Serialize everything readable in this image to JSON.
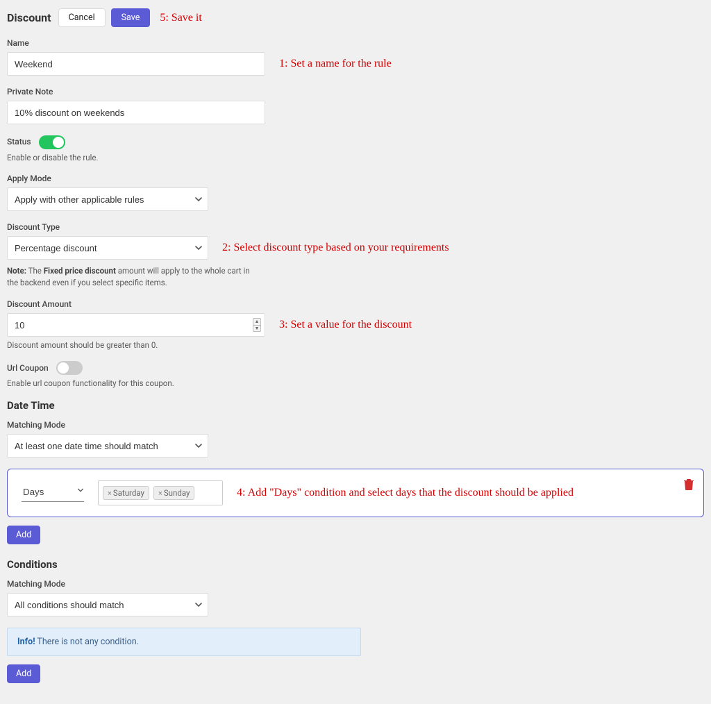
{
  "header": {
    "title": "Discount",
    "cancel": "Cancel",
    "save": "Save",
    "annot5": "5: Save it"
  },
  "name": {
    "label": "Name",
    "value": "Weekend",
    "annot1": "1: Set a name for the rule"
  },
  "privateNote": {
    "label": "Private Note",
    "value": "10% discount on weekends"
  },
  "status": {
    "label": "Status",
    "help": "Enable or disable the rule.",
    "on": true
  },
  "applyMode": {
    "label": "Apply Mode",
    "value": "Apply with other applicable rules"
  },
  "discountType": {
    "label": "Discount Type",
    "value": "Percentage discount",
    "annot2": "2: Select discount type based on your requirements",
    "note_prefix": "Note:",
    "note_bold": "Fixed price discount",
    "note_before": " The ",
    "note_after": " amount will apply to the whole cart in the backend even if you select specific items."
  },
  "discountAmount": {
    "label": "Discount Amount",
    "value": "10",
    "help": "Discount amount should be greater than 0.",
    "annot3": "3: Set a value for the discount"
  },
  "urlCoupon": {
    "label": "Url Coupon",
    "help": "Enable url coupon functionality for this coupon.",
    "on": false
  },
  "dateTime": {
    "heading": "Date Time",
    "matchLabel": "Matching Mode",
    "matchValue": "At least one date time should match",
    "ruleType": "Days",
    "tags": [
      "Saturday",
      "Sunday"
    ],
    "annot4": "4: Add \"Days\" condition and select days that the discount should be applied",
    "addLabel": "Add"
  },
  "conditions": {
    "heading": "Conditions",
    "matchLabel": "Matching Mode",
    "matchValue": "All conditions should match",
    "info_bold": "Info!",
    "info_text": " There is not any condition.",
    "addLabel": "Add"
  }
}
